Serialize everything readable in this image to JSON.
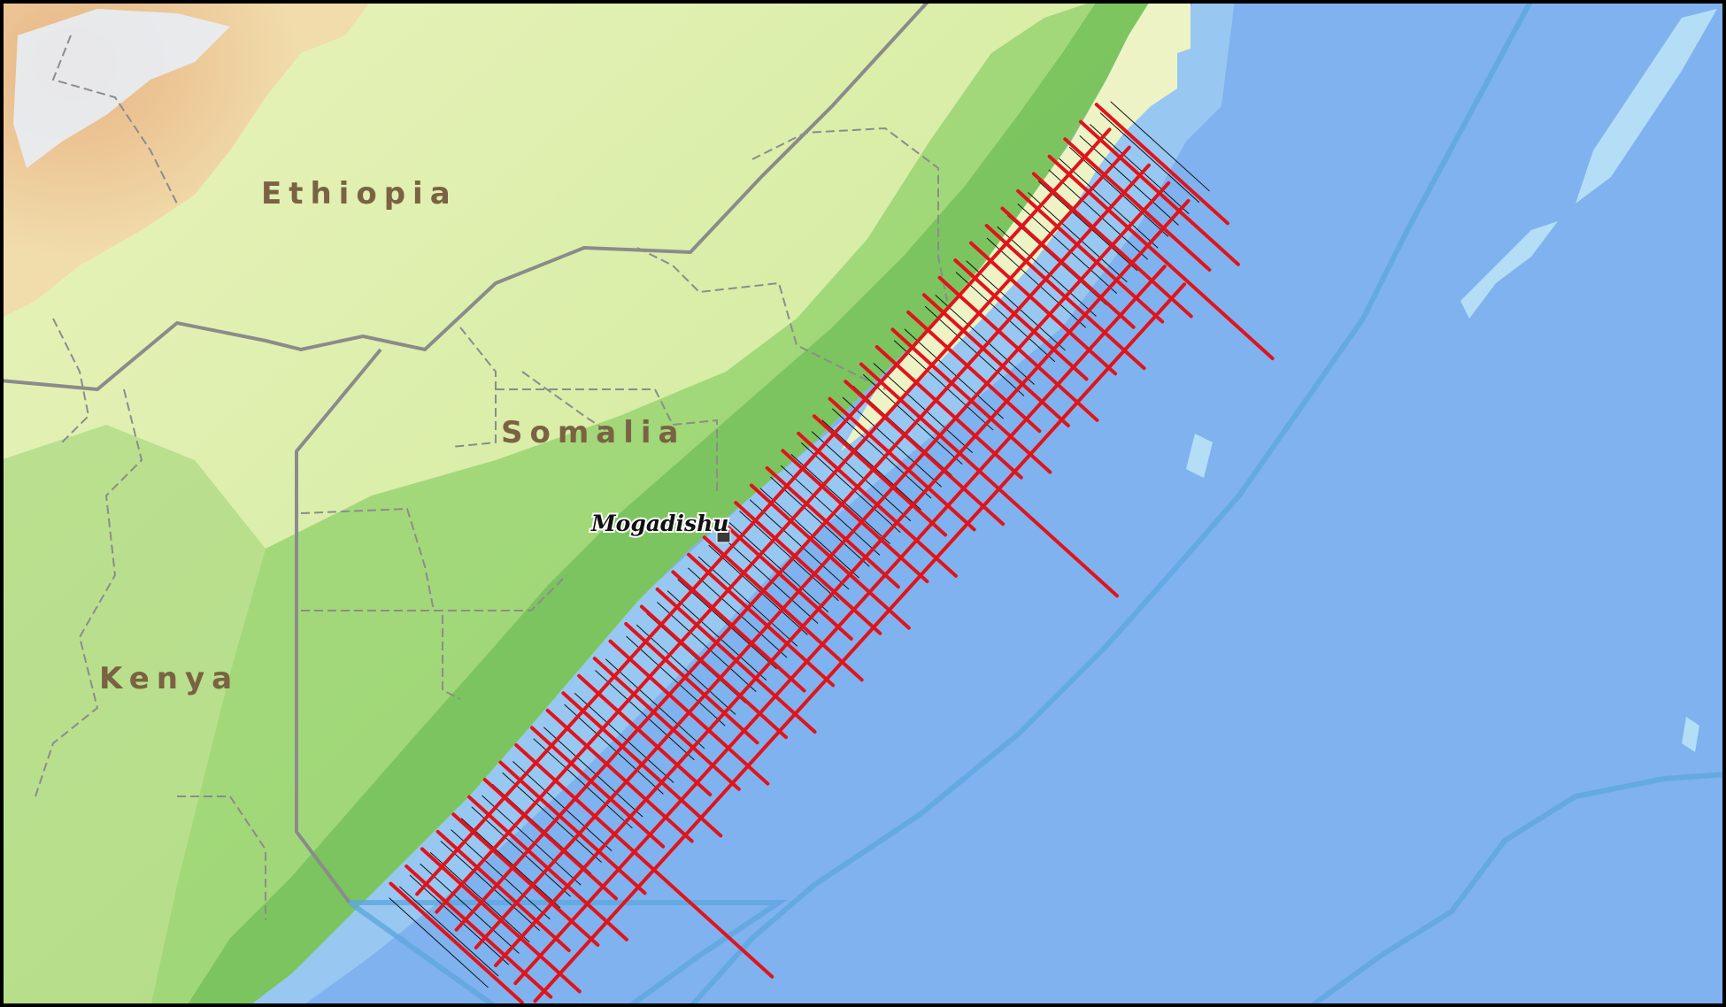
{
  "map": {
    "labels": {
      "ethiopia": "Ethiopia",
      "somalia": "Somalia",
      "kenya": "Kenya",
      "mogadishu": "Mogadishu"
    },
    "colors": {
      "ocean_deep": "#7fb2ee",
      "ocean_shallow": "#b8e2f6",
      "land_light": "#e6f2b8",
      "land_mid": "#b9df8c",
      "land_dark": "#63b84c",
      "highland": "#e7b98a",
      "snow": "#e6ecf5",
      "border": "#8b8b8b",
      "survey_line": "#e0141a",
      "frame": "#000000"
    }
  }
}
